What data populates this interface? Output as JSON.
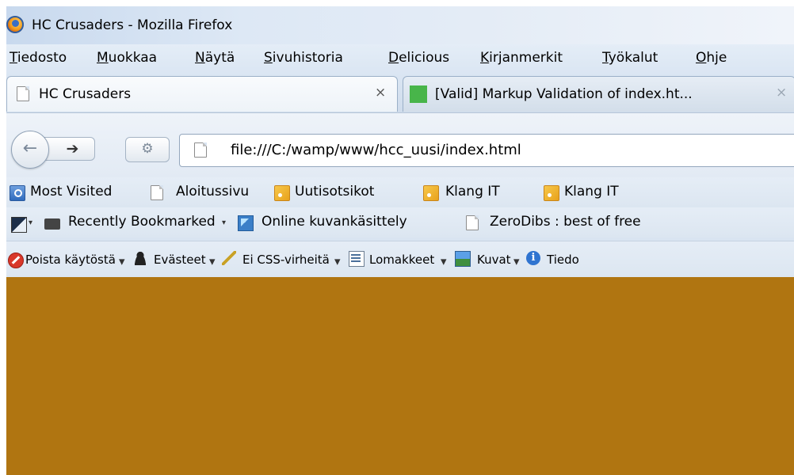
{
  "window": {
    "title": "HC Crusaders - Mozilla Firefox"
  },
  "menu": [
    "Tiedosto",
    "Muokkaa",
    "Näytä",
    "Sivuhistoria",
    "Delicious",
    "Kirjanmerkit",
    "Työkalut",
    "Ohje"
  ],
  "tabs": [
    {
      "label": "HC Crusaders",
      "close": "×",
      "active": true
    },
    {
      "label": "[Valid] Markup Validation of index.ht...",
      "close": "×",
      "active": false
    }
  ],
  "nav": {
    "back": "←",
    "forward": "➔",
    "url": "file:///C:/wamp/www/hcc_uusi/index.html"
  },
  "bookmarks_bar": [
    {
      "label": "Most Visited",
      "icon": "most-visited-icon"
    },
    {
      "label": "Aloitussivu",
      "icon": "page-icon"
    },
    {
      "label": "Uutisotsikot",
      "icon": "rss-icon"
    },
    {
      "label": "Klang IT",
      "icon": "rss-icon"
    },
    {
      "label": "Klang IT",
      "icon": "rss-icon"
    }
  ],
  "bookmarks_bar_2": [
    {
      "label": "Recently Bookmarked",
      "icon": "screen-icon"
    },
    {
      "label": "Online kuvankäsittely",
      "icon": "image-tool-icon"
    },
    {
      "label": "ZeroDibs : best of free",
      "icon": "page-icon"
    }
  ],
  "webdev_toolbar": [
    {
      "label": "Poista käytöstä",
      "icon": "disable-icon"
    },
    {
      "label": "Evästeet",
      "icon": "cookies-icon"
    },
    {
      "label": "Ei CSS-virheitä",
      "icon": "css-icon"
    },
    {
      "label": "Lomakkeet",
      "icon": "forms-icon"
    },
    {
      "label": "Kuvat",
      "icon": "images-icon"
    },
    {
      "label": "Tiedo",
      "icon": "info-icon"
    }
  ],
  "page": {
    "background": "#b07511"
  }
}
